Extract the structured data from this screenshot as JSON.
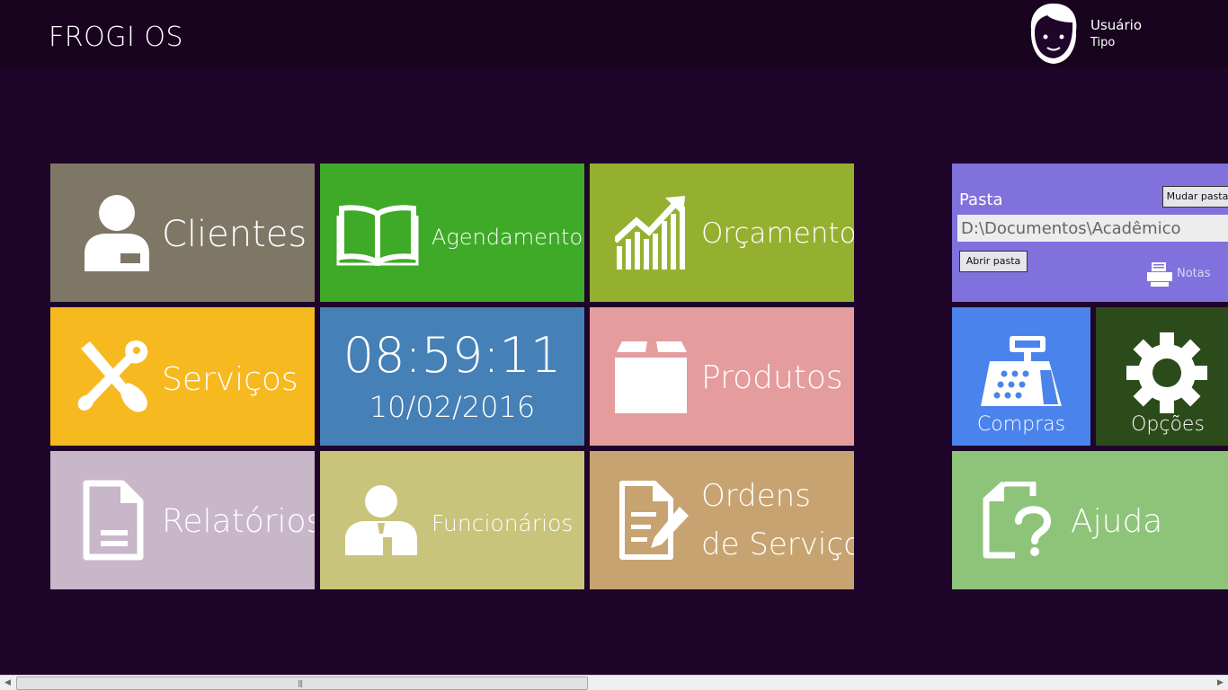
{
  "header": {
    "app_title": "FROGI OS",
    "user_name": "Usuário",
    "user_type": "Tipo"
  },
  "tiles": {
    "clientes": {
      "label": "Clientes",
      "icon": "person-icon",
      "color": "#7e7766"
    },
    "agendamentos": {
      "label": "Agendamentos",
      "icon": "book-icon",
      "color": "#3fa928"
    },
    "orcamentos": {
      "label": "Orçamentos",
      "icon": "chart-growth-icon",
      "color": "#95b02f"
    },
    "servicos": {
      "label": "Serviços",
      "icon": "tools-icon",
      "color": "#f6b920"
    },
    "clock": {
      "time": "08:59:11",
      "date": "10/02/2016",
      "color": "#4580b6"
    },
    "produtos": {
      "label": "Produtos",
      "icon": "box-icon",
      "color": "#e59c9d"
    },
    "relatorios": {
      "label": "Relatórios",
      "icon": "document-icon",
      "color": "#c8b6c9"
    },
    "funcionarios": {
      "label": "Funcionários",
      "icon": "employee-icon",
      "color": "#c8c47b"
    },
    "ordens": {
      "label_line1": "Ordens",
      "label_line2": "de Serviço",
      "icon": "edit-document-icon",
      "color": "#c7a371"
    },
    "compras": {
      "label": "Compras",
      "icon": "cash-register-icon",
      "color": "#4a83ec"
    },
    "opcoes": {
      "label": "Opções",
      "icon": "gear-icon",
      "color": "#2c4b1a"
    },
    "ajuda": {
      "label": "Ajuda",
      "icon": "help-document-icon",
      "color": "#8ec479"
    }
  },
  "folder_panel": {
    "label": "Pasta",
    "change_button": "Mudar pasta",
    "path_value": "D:\\Documentos\\Acadêmico",
    "open_button": "Abrir pasta",
    "notes_label": "Notas",
    "color": "#8071dd"
  }
}
